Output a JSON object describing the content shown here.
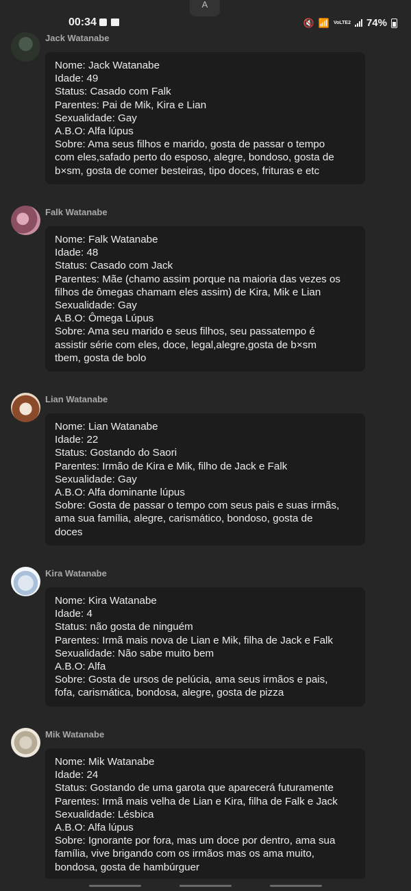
{
  "status_bar": {
    "time": "00:34",
    "battery": "74%",
    "volte": "VoLTE2",
    "top_handle": "A"
  },
  "messages": [
    {
      "sender": "Jack Watanabe",
      "lines": [
        "Nome: Jack Watanabe",
        "Idade: 49",
        "Status: Casado com Falk",
        "Parentes: Pai de Mik, Kira e Lian",
        "Sexualidade: Gay",
        "A.B.O: Alfa lúpus",
        "Sobre: Ama seus filhos e marido, gosta de passar o tempo",
        "com eles,safado perto do esposo, alegre, bondoso, gosta de",
        "b×sm, gosta de comer besteiras, tipo doces, frituras e etc"
      ]
    },
    {
      "sender": "Falk Watanabe",
      "lines": [
        "Nome: Falk Watanabe",
        "Idade: 48",
        "Status: Casado com Jack",
        "Parentes: Mãe (chamo assim porque na maioria das vezes os",
        "filhos de ômegas chamam eles assim) de Kira, Mik e Lian",
        "Sexualidade: Gay",
        "A.B.O: Ômega Lúpus",
        "Sobre: Ama seu marido e seus filhos, seu passatempo é",
        "assistir série com eles, doce, legal,alegre,gosta de b×sm",
        "tbem, gosta de bolo"
      ]
    },
    {
      "sender": "Lian Watanabe",
      "lines": [
        "Nome: Lian Watanabe",
        "Idade: 22",
        "Status: Gostando do Saori",
        "Parentes: Irmão de Kira e Mik, filho de Jack e Falk",
        "Sexualidade: Gay",
        "A.B.O: Alfa dominante lúpus",
        "Sobre: Gosta de passar o tempo com seus pais e suas irmãs,",
        "ama sua família, alegre, carismático, bondoso, gosta de",
        "doces"
      ]
    },
    {
      "sender": "Kira Watanabe",
      "lines": [
        "Nome: Kira Watanabe",
        "Idade: 4",
        "Status: não gosta de ninguém",
        "Parentes: Irmã mais nova de Lian e Mik, filha de Jack e Falk",
        "Sexualidade: Não sabe muito bem",
        "A.B.O: Alfa",
        "Sobre: Gosta de ursos de pelúcia, ama seus irmãos e pais,",
        "fofa, carismática, bondosa, alegre, gosta de pizza"
      ]
    },
    {
      "sender": "Mik Watanabe",
      "lines": [
        "Nome: Mik Watanabe",
        "Idade: 24",
        "Status: Gostando de uma garota que aparecerá futuramente",
        "Parentes: Irmã mais velha de Lian e Kira, filha de Falk e Jack",
        "Sexualidade: Lésbica",
        "A.B.O: Alfa lúpus",
        "Sobre: Ignorante por fora, mas um doce por dentro, ama sua",
        "família, vive brigando com os irmãos mas os ama muito,",
        "bondosa, gosta de hambúrguer"
      ]
    }
  ]
}
